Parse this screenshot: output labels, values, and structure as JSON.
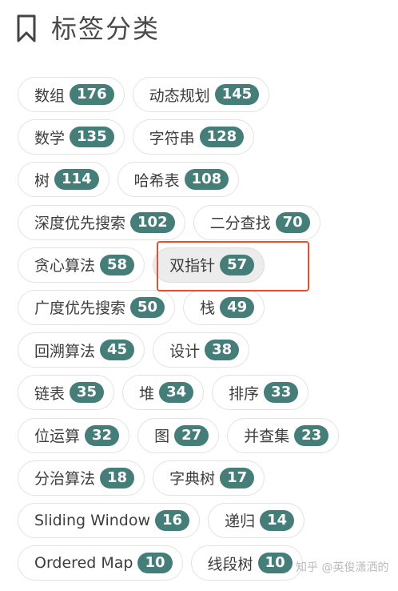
{
  "header": {
    "title": "标签分类",
    "icon": "bookmark-icon"
  },
  "tags": [
    [
      {
        "label": "数组",
        "count": "176"
      },
      {
        "label": "动态规划",
        "count": "145"
      }
    ],
    [
      {
        "label": "数学",
        "count": "135"
      },
      {
        "label": "字符串",
        "count": "128"
      }
    ],
    [
      {
        "label": "树",
        "count": "114"
      },
      {
        "label": "哈希表",
        "count": "108"
      }
    ],
    [
      {
        "label": "深度优先搜索",
        "count": "102"
      },
      {
        "label": "二分查找",
        "count": "70"
      }
    ],
    [
      {
        "label": "贪心算法",
        "count": "58"
      },
      {
        "label": "双指针",
        "count": "57",
        "active": true
      }
    ],
    [
      {
        "label": "广度优先搜索",
        "count": "50"
      },
      {
        "label": "栈",
        "count": "49"
      }
    ],
    [
      {
        "label": "回溯算法",
        "count": "45"
      },
      {
        "label": "设计",
        "count": "38"
      }
    ],
    [
      {
        "label": "链表",
        "count": "35"
      },
      {
        "label": "堆",
        "count": "34"
      },
      {
        "label": "排序",
        "count": "33"
      }
    ],
    [
      {
        "label": "位运算",
        "count": "32"
      },
      {
        "label": "图",
        "count": "27"
      },
      {
        "label": "并查集",
        "count": "23"
      }
    ],
    [
      {
        "label": "分治算法",
        "count": "18"
      },
      {
        "label": "字典树",
        "count": "17"
      }
    ],
    [
      {
        "label": "Sliding Window",
        "count": "16"
      },
      {
        "label": "递归",
        "count": "14"
      }
    ],
    [
      {
        "label": "Ordered Map",
        "count": "10"
      },
      {
        "label": "线段树",
        "count": "10"
      }
    ]
  ],
  "colors": {
    "count_badge": "#457d78",
    "highlight_box": "#e2502d",
    "active_tag": "#ececec"
  },
  "watermark": "知乎 @英俊潇洒的"
}
